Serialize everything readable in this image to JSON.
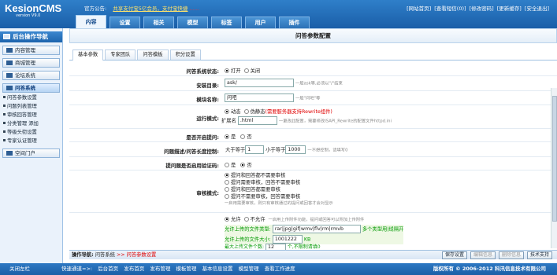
{
  "header": {
    "logo_name": "KesionCMS",
    "logo_version": "version V9.0",
    "notice_label": "官方公告:",
    "notice_text": "共享支付宝5亿会员，支付宝快捷",
    "notice_hot": "......",
    "links": [
      "[网站首页]",
      "[查看短信(0)]",
      "[修改密码]",
      "[更新缓存]",
      "[安全退出]"
    ]
  },
  "tabs": [
    "内容",
    "设置",
    "相关",
    "模型",
    "标签",
    "用户",
    "插件"
  ],
  "sidebar": {
    "title": "后台操作导航",
    "menus": [
      "内容管理",
      "商城管理",
      "论坛系统",
      "问答系统"
    ],
    "sub_items": [
      "问答参数设置",
      "问题列表管理",
      "审核回答管理",
      "分类管理 添加",
      "等级头衔设置",
      "专家认证管理"
    ],
    "bottom_menu": "空间门户"
  },
  "page": {
    "title": "问答参数配置",
    "subtabs": [
      "基本参数",
      "专家团队",
      "问答模板",
      "积分设置"
    ]
  },
  "form": {
    "status": {
      "label": "问答系统状态:",
      "on": "打开",
      "off": "关闭"
    },
    "dir": {
      "label": "安装目录:",
      "value": "ask/",
      "hint": "一般ask等,必须以\"/\"结束"
    },
    "module_name": {
      "label": "模块名称:",
      "value": "问吧",
      "hint": "一般\"问吧\"等"
    },
    "run_mode": {
      "label": "运行模式:",
      "dynamic": "动态",
      "pseudo": "伪静态",
      "pseudo_note": "(需要服务器支持Rewrite组件)",
      "ext_label": "扩展名",
      "ext_value": ".html",
      "ext_hint": "一更改此配置，需要修改ISAPI_Rewrite的配置文件httpd.ini"
    },
    "guest": {
      "label": "是否开启提问:",
      "yes": "是",
      "no": "否"
    },
    "length": {
      "label": "问题描述/问答长度控制:",
      "gt": "大于等于",
      "gt_value": "1",
      "lt": "小于等于",
      "lt_value": "1000",
      "hint": "一不想控制，请填写0"
    },
    "verify": {
      "label": "提问题是否启用验证码:",
      "yes": "是",
      "no": "否"
    },
    "audit": {
      "label": "审核模式:",
      "options": [
        "提问和回答都不需要审核",
        "提问需要审核，回答不需要审核",
        "提问和回答都需要审核",
        "提问不需要审核，回答需要审核"
      ],
      "hint": "一启用需要审核，则只有审核通过的提问或回答才会对显示"
    },
    "upload": {
      "allow": "允许",
      "deny": "不允许",
      "hint": "一启用上传附件功能，提问或回答可以附加上传附件",
      "types_label": "允许上传的文件类型:",
      "types_value": "rar|jpg|gif|wmv|flv|rm|rmvb",
      "types_hint": "多个类型用|线隔开",
      "size_label": "允许上传的文件大小:",
      "size_value": "1001222",
      "size_unit": "KB",
      "count_label": "最大上传文件个数:",
      "count_value": "12",
      "count_hint": "个,不限制请填0"
    }
  },
  "actionbar": {
    "nav_label": "操作导航:",
    "crumb1": "问答系统",
    "arrow": ">>",
    "crumb2": "问答参数设置",
    "buttons": [
      "保存设置",
      "编辑信息",
      "删除信息",
      "技术支持"
    ]
  },
  "footer": {
    "left": "关闭左栏",
    "quick_label": "快速通道=>:",
    "quick_links": [
      "后台首页",
      "发布首页",
      "发布管理",
      "模板管理",
      "基本信息设置",
      "模型管理",
      "查看工作进度"
    ],
    "copyright": "版权所有 © 2006-2012 科汛信息技术有限公司"
  }
}
